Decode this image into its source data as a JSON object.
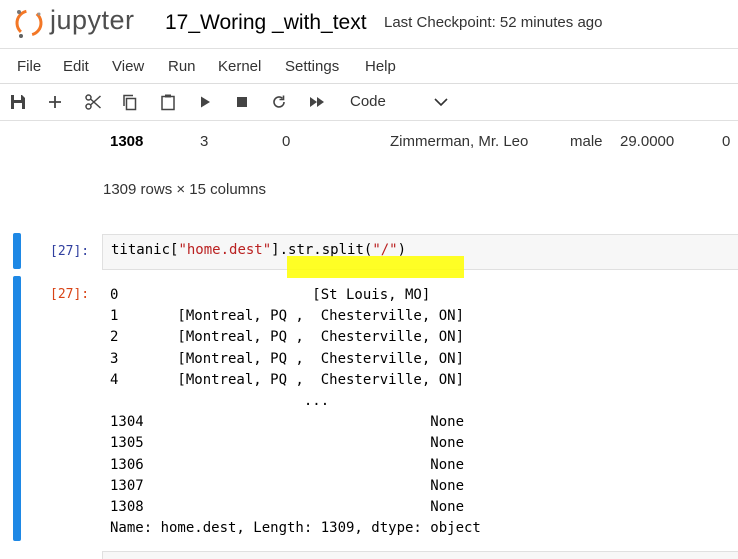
{
  "header": {
    "logo_text": "jupyter",
    "notebook_title": "17_Woring _with_text",
    "checkpoint": "Last Checkpoint: 52 minutes ago"
  },
  "menu": [
    "File",
    "Edit",
    "View",
    "Run",
    "Kernel",
    "Settings",
    "Help"
  ],
  "toolbar": {
    "buttons": [
      "save-icon",
      "add-icon",
      "cut-icon",
      "copy-icon",
      "paste-icon",
      "run-icon",
      "stop-icon",
      "restart-icon",
      "fast-forward-icon"
    ],
    "cell_type": "Code"
  },
  "dataframe_tail": {
    "index": "1308",
    "cells": [
      "3",
      "0",
      "Zimmerman, Mr. Leo",
      "male",
      "29.0000",
      "0"
    ],
    "shape": "1309 rows × 15 columns"
  },
  "cell_27": {
    "in_prompt": "[27]:",
    "out_prompt": "[27]:",
    "code": {
      "part1": "titanic[",
      "part2": "\"home.dest\"",
      "part3": "].str.split(",
      "part4": "\"/\"",
      "part5": ")"
    },
    "output_lines": [
      "0                       [St Louis, MO]",
      "1       [Montreal, PQ ,  Chesterville, ON]",
      "2       [Montreal, PQ ,  Chesterville, ON]",
      "3       [Montreal, PQ ,  Chesterville, ON]",
      "4       [Montreal, PQ ,  Chesterville, ON]",
      "                       ...",
      "1304                                  None",
      "1305                                  None",
      "1306                                  None",
      "1307                                  None",
      "1308                                  None",
      "Name: home.dest, Length: 1309, dtype: object"
    ]
  }
}
